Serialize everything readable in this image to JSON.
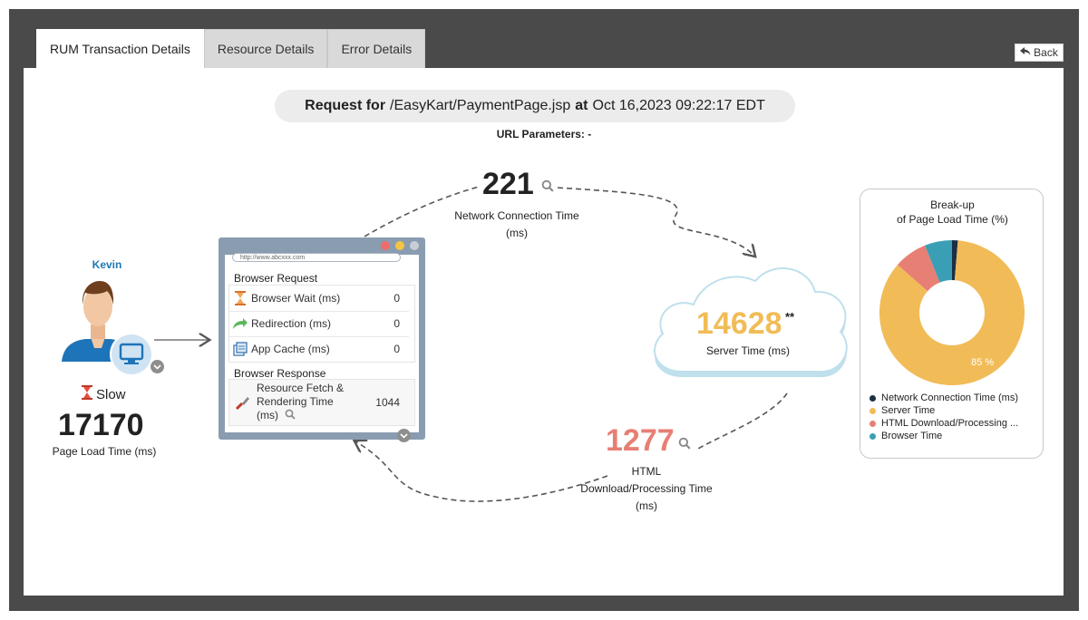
{
  "tabs": [
    {
      "label": "RUM Transaction Details",
      "active": true
    },
    {
      "label": "Resource Details",
      "active": false
    },
    {
      "label": "Error Details",
      "active": false
    }
  ],
  "back_button": {
    "label": "Back"
  },
  "request": {
    "prefix": "Request for",
    "url": "/EasyKart/PaymentPage.jsp",
    "at": "at",
    "time": "Oct 16,2023 09:22:17 EDT",
    "url_params_label": "URL Parameters: -"
  },
  "user": {
    "name": "Kevin",
    "status": "Slow",
    "page_load_time": "17170",
    "page_load_label": "Page Load Time (ms)"
  },
  "browser": {
    "address": "http://www.abcxxx.com",
    "request_title": "Browser Request",
    "request_rows": [
      {
        "label": "Browser Wait (ms)",
        "value": "0",
        "icon": "hourglass-icon"
      },
      {
        "label": "Redirection (ms)",
        "value": "0",
        "icon": "redirect-arrow-icon"
      },
      {
        "label": "App Cache (ms)",
        "value": "0",
        "icon": "cache-icon"
      }
    ],
    "response_title": "Browser Response",
    "response_rows": [
      {
        "label_line1": "Resource Fetch &",
        "label_line2": "Rendering Time",
        "label_line3": "(ms)",
        "value": "1044",
        "icon": "brush-icon"
      }
    ]
  },
  "network": {
    "value": "221",
    "label_line1": "Network Connection Time",
    "label_line2": "(ms)"
  },
  "server": {
    "value": "14628",
    "star": "**",
    "label": "Server Time (ms)"
  },
  "html": {
    "value": "1277",
    "label_line1": "HTML",
    "label_line2": "Download/Processing Time",
    "label_line3": "(ms)"
  },
  "breakup": {
    "title_line1": "Break-up",
    "title_line2": "of Page Load Time (%)",
    "slice_label": "85 %",
    "legend": [
      {
        "label": "Network Connection Time (ms)",
        "color": "#1d2f45"
      },
      {
        "label": "Server Time",
        "color": "#f1bc57"
      },
      {
        "label": "HTML Download/Processing ...",
        "color": "#e77f74"
      },
      {
        "label": "Browser Time",
        "color": "#3a9fb5"
      }
    ]
  },
  "chart_data": {
    "type": "pie",
    "title": "Break-up of Page Load Time (%)",
    "categories": [
      "Network Connection Time (ms)",
      "Server Time",
      "HTML Download/Processing ...",
      "Browser Time"
    ],
    "values": [
      1.3,
      85.2,
      7.4,
      6.1
    ],
    "colors": [
      "#1d2f45",
      "#f1bc57",
      "#e77f74",
      "#3a9fb5"
    ],
    "data_labels": [
      "",
      "85 %",
      "",
      ""
    ],
    "donut": true,
    "legend_position": "bottom"
  }
}
